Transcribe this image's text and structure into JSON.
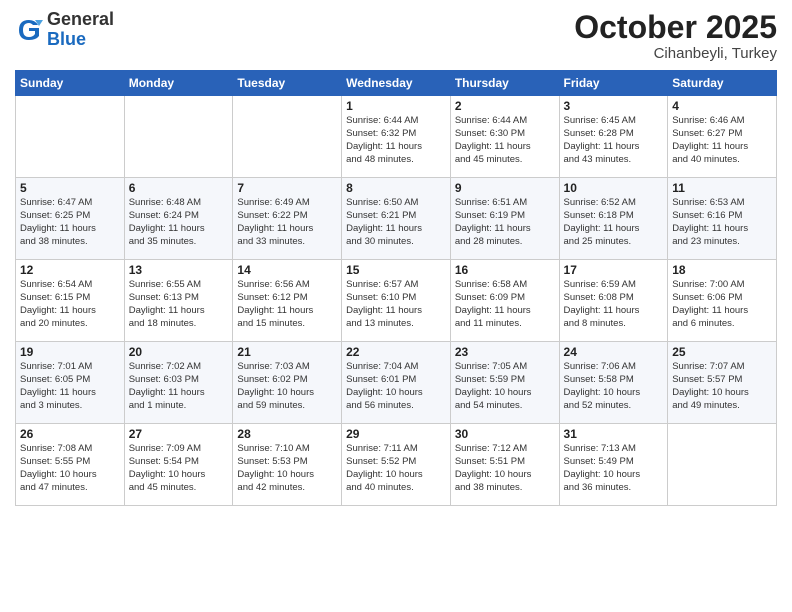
{
  "logo": {
    "general": "General",
    "blue": "Blue"
  },
  "title": "October 2025",
  "subtitle": "Cihanbeyli, Turkey",
  "weekdays": [
    "Sunday",
    "Monday",
    "Tuesday",
    "Wednesday",
    "Thursday",
    "Friday",
    "Saturday"
  ],
  "weeks": [
    [
      {
        "day": "",
        "info": ""
      },
      {
        "day": "",
        "info": ""
      },
      {
        "day": "",
        "info": ""
      },
      {
        "day": "1",
        "info": "Sunrise: 6:44 AM\nSunset: 6:32 PM\nDaylight: 11 hours\nand 48 minutes."
      },
      {
        "day": "2",
        "info": "Sunrise: 6:44 AM\nSunset: 6:30 PM\nDaylight: 11 hours\nand 45 minutes."
      },
      {
        "day": "3",
        "info": "Sunrise: 6:45 AM\nSunset: 6:28 PM\nDaylight: 11 hours\nand 43 minutes."
      },
      {
        "day": "4",
        "info": "Sunrise: 6:46 AM\nSunset: 6:27 PM\nDaylight: 11 hours\nand 40 minutes."
      }
    ],
    [
      {
        "day": "5",
        "info": "Sunrise: 6:47 AM\nSunset: 6:25 PM\nDaylight: 11 hours\nand 38 minutes."
      },
      {
        "day": "6",
        "info": "Sunrise: 6:48 AM\nSunset: 6:24 PM\nDaylight: 11 hours\nand 35 minutes."
      },
      {
        "day": "7",
        "info": "Sunrise: 6:49 AM\nSunset: 6:22 PM\nDaylight: 11 hours\nand 33 minutes."
      },
      {
        "day": "8",
        "info": "Sunrise: 6:50 AM\nSunset: 6:21 PM\nDaylight: 11 hours\nand 30 minutes."
      },
      {
        "day": "9",
        "info": "Sunrise: 6:51 AM\nSunset: 6:19 PM\nDaylight: 11 hours\nand 28 minutes."
      },
      {
        "day": "10",
        "info": "Sunrise: 6:52 AM\nSunset: 6:18 PM\nDaylight: 11 hours\nand 25 minutes."
      },
      {
        "day": "11",
        "info": "Sunrise: 6:53 AM\nSunset: 6:16 PM\nDaylight: 11 hours\nand 23 minutes."
      }
    ],
    [
      {
        "day": "12",
        "info": "Sunrise: 6:54 AM\nSunset: 6:15 PM\nDaylight: 11 hours\nand 20 minutes."
      },
      {
        "day": "13",
        "info": "Sunrise: 6:55 AM\nSunset: 6:13 PM\nDaylight: 11 hours\nand 18 minutes."
      },
      {
        "day": "14",
        "info": "Sunrise: 6:56 AM\nSunset: 6:12 PM\nDaylight: 11 hours\nand 15 minutes."
      },
      {
        "day": "15",
        "info": "Sunrise: 6:57 AM\nSunset: 6:10 PM\nDaylight: 11 hours\nand 13 minutes."
      },
      {
        "day": "16",
        "info": "Sunrise: 6:58 AM\nSunset: 6:09 PM\nDaylight: 11 hours\nand 11 minutes."
      },
      {
        "day": "17",
        "info": "Sunrise: 6:59 AM\nSunset: 6:08 PM\nDaylight: 11 hours\nand 8 minutes."
      },
      {
        "day": "18",
        "info": "Sunrise: 7:00 AM\nSunset: 6:06 PM\nDaylight: 11 hours\nand 6 minutes."
      }
    ],
    [
      {
        "day": "19",
        "info": "Sunrise: 7:01 AM\nSunset: 6:05 PM\nDaylight: 11 hours\nand 3 minutes."
      },
      {
        "day": "20",
        "info": "Sunrise: 7:02 AM\nSunset: 6:03 PM\nDaylight: 11 hours\nand 1 minute."
      },
      {
        "day": "21",
        "info": "Sunrise: 7:03 AM\nSunset: 6:02 PM\nDaylight: 10 hours\nand 59 minutes."
      },
      {
        "day": "22",
        "info": "Sunrise: 7:04 AM\nSunset: 6:01 PM\nDaylight: 10 hours\nand 56 minutes."
      },
      {
        "day": "23",
        "info": "Sunrise: 7:05 AM\nSunset: 5:59 PM\nDaylight: 10 hours\nand 54 minutes."
      },
      {
        "day": "24",
        "info": "Sunrise: 7:06 AM\nSunset: 5:58 PM\nDaylight: 10 hours\nand 52 minutes."
      },
      {
        "day": "25",
        "info": "Sunrise: 7:07 AM\nSunset: 5:57 PM\nDaylight: 10 hours\nand 49 minutes."
      }
    ],
    [
      {
        "day": "26",
        "info": "Sunrise: 7:08 AM\nSunset: 5:55 PM\nDaylight: 10 hours\nand 47 minutes."
      },
      {
        "day": "27",
        "info": "Sunrise: 7:09 AM\nSunset: 5:54 PM\nDaylight: 10 hours\nand 45 minutes."
      },
      {
        "day": "28",
        "info": "Sunrise: 7:10 AM\nSunset: 5:53 PM\nDaylight: 10 hours\nand 42 minutes."
      },
      {
        "day": "29",
        "info": "Sunrise: 7:11 AM\nSunset: 5:52 PM\nDaylight: 10 hours\nand 40 minutes."
      },
      {
        "day": "30",
        "info": "Sunrise: 7:12 AM\nSunset: 5:51 PM\nDaylight: 10 hours\nand 38 minutes."
      },
      {
        "day": "31",
        "info": "Sunrise: 7:13 AM\nSunset: 5:49 PM\nDaylight: 10 hours\nand 36 minutes."
      },
      {
        "day": "",
        "info": ""
      }
    ]
  ]
}
